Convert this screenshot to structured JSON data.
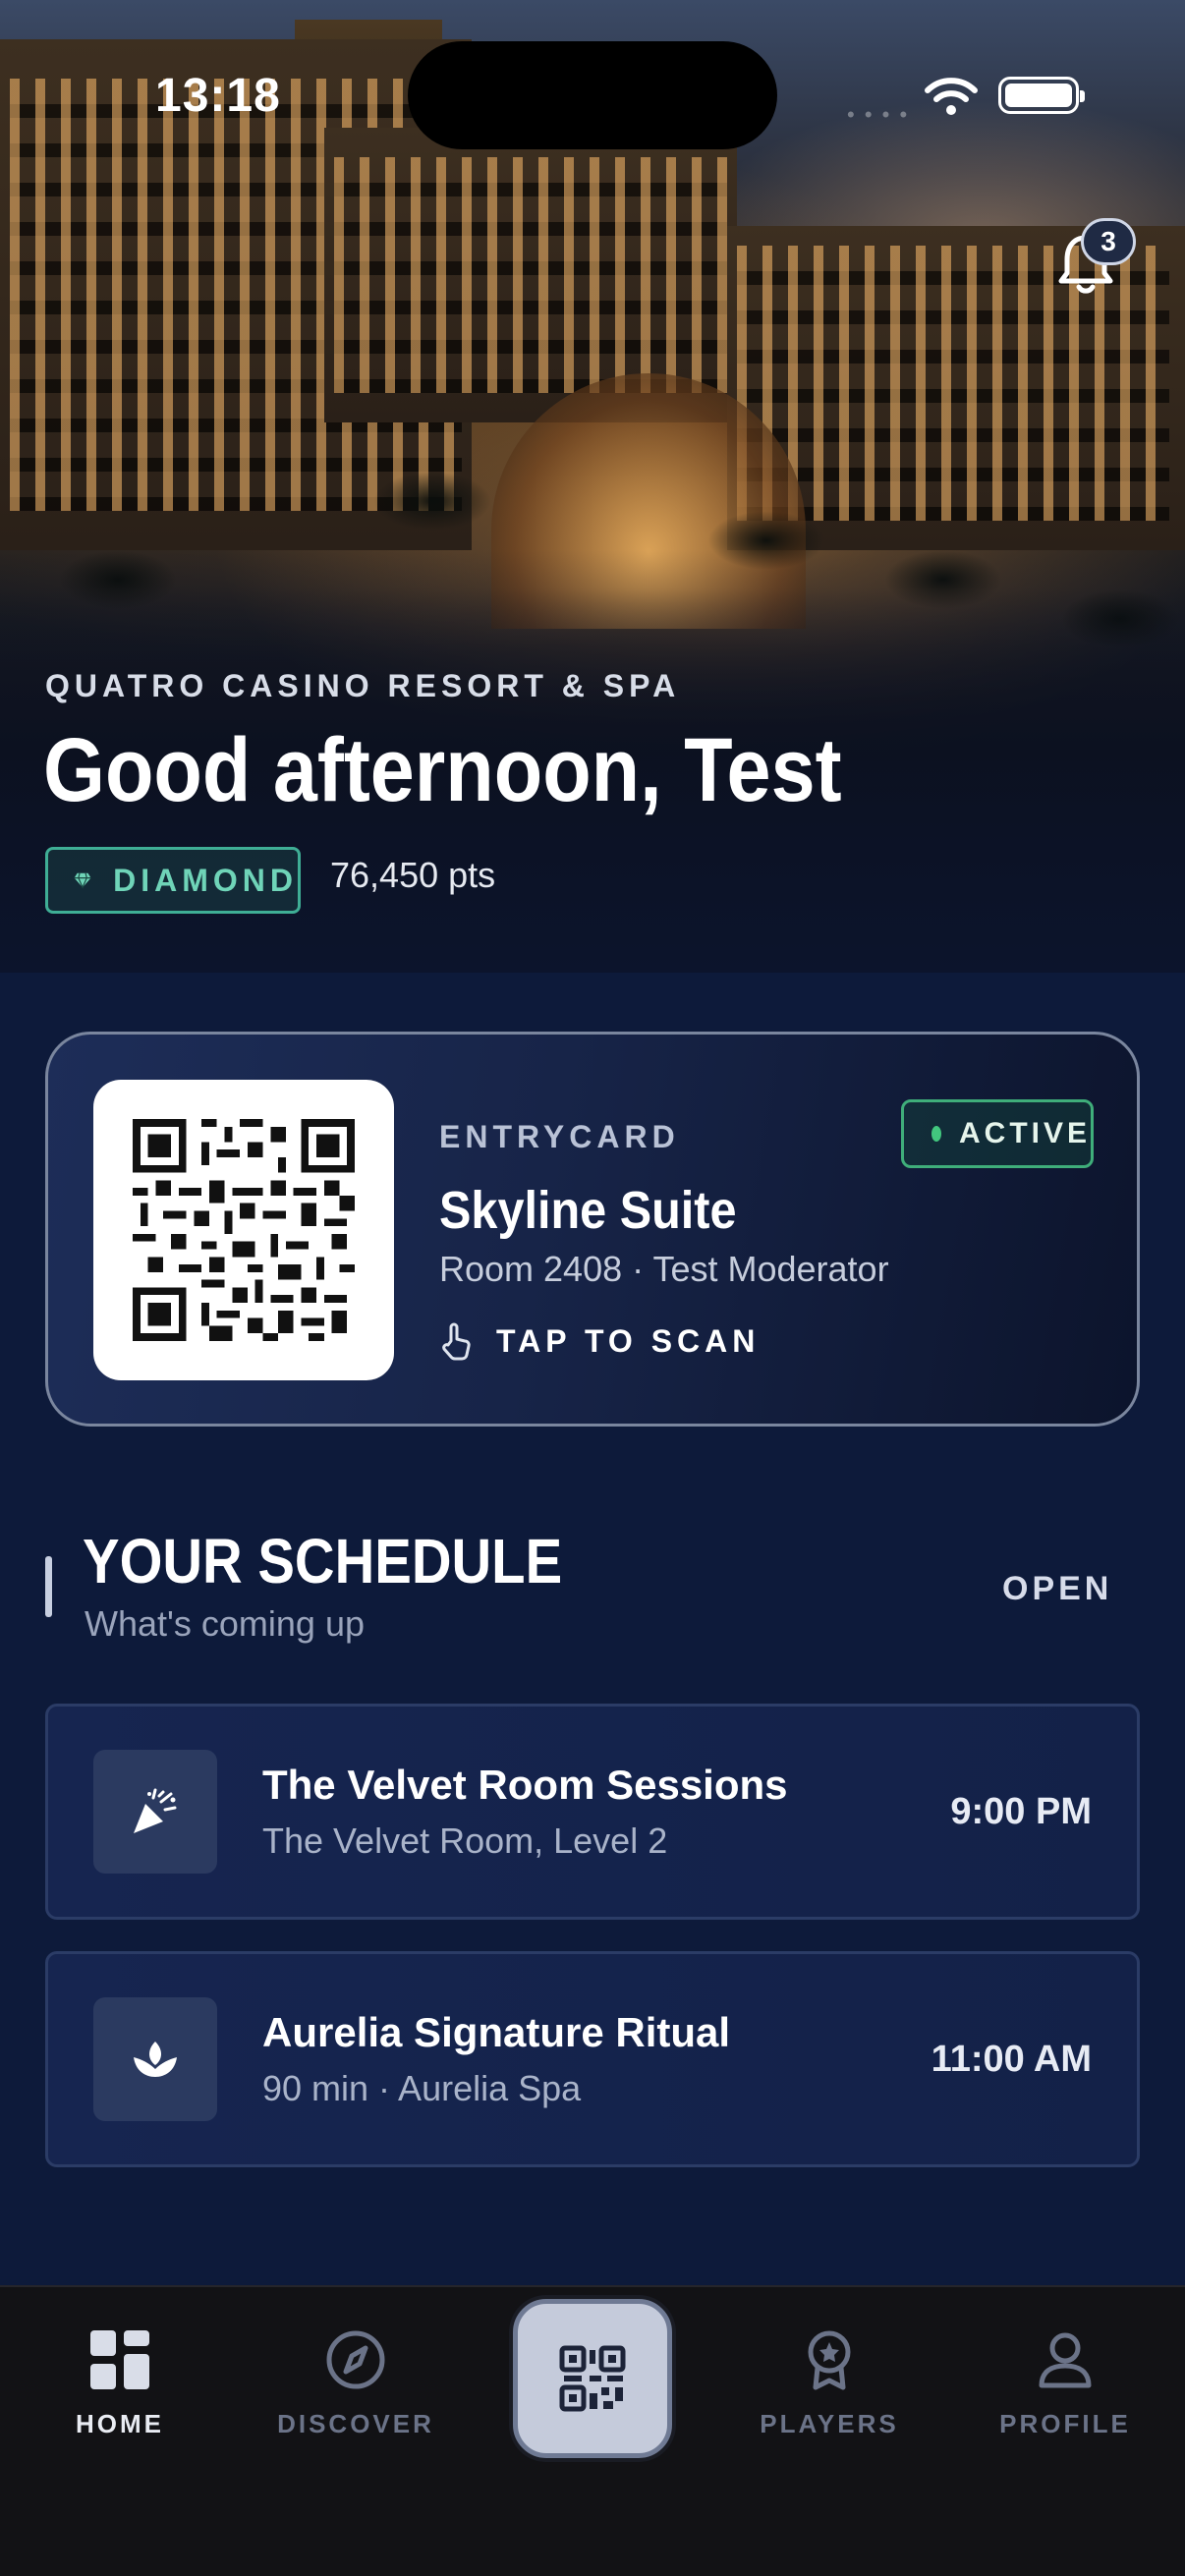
{
  "status_bar": {
    "time": "13:18"
  },
  "notifications": {
    "count": "3"
  },
  "hero": {
    "resort_name": "QUATRO CASINO RESORT & SPA",
    "greeting": "Good afternoon, Test",
    "tier": "DIAMOND",
    "points": "76,450 pts"
  },
  "entry_card": {
    "kicker": "ENTRYCARD",
    "status": "ACTIVE",
    "title": "Skyline Suite",
    "subtitle": "Room 2408 · Test Moderator",
    "action": "TAP TO SCAN"
  },
  "schedule": {
    "title": "YOUR SCHEDULE",
    "subtitle": "What's coming up",
    "open_label": "OPEN",
    "items": [
      {
        "icon": "party-popper-icon",
        "title": "The Velvet Room Sessions",
        "subtitle": "The Velvet Room, Level 2",
        "time": "9:00 PM"
      },
      {
        "icon": "lotus-icon",
        "title": "Aurelia Signature Ritual",
        "subtitle": "90 min · Aurelia Spa",
        "time": "11:00 AM"
      }
    ]
  },
  "tabbar": {
    "tabs": [
      {
        "label": "HOME",
        "icon": "grid-icon",
        "active": true
      },
      {
        "label": "DISCOVER",
        "icon": "compass-icon",
        "active": false
      },
      {
        "label": "",
        "icon": "qr-code-icon",
        "active": false
      },
      {
        "label": "PLAYERS",
        "icon": "award-icon",
        "active": false
      },
      {
        "label": "PROFILE",
        "icon": "user-icon",
        "active": false
      }
    ]
  },
  "colors": {
    "background": "#0d1a3a",
    "accent_teal": "#6fd4b8",
    "active_green": "#42c77e",
    "tabbar": "#121215"
  }
}
